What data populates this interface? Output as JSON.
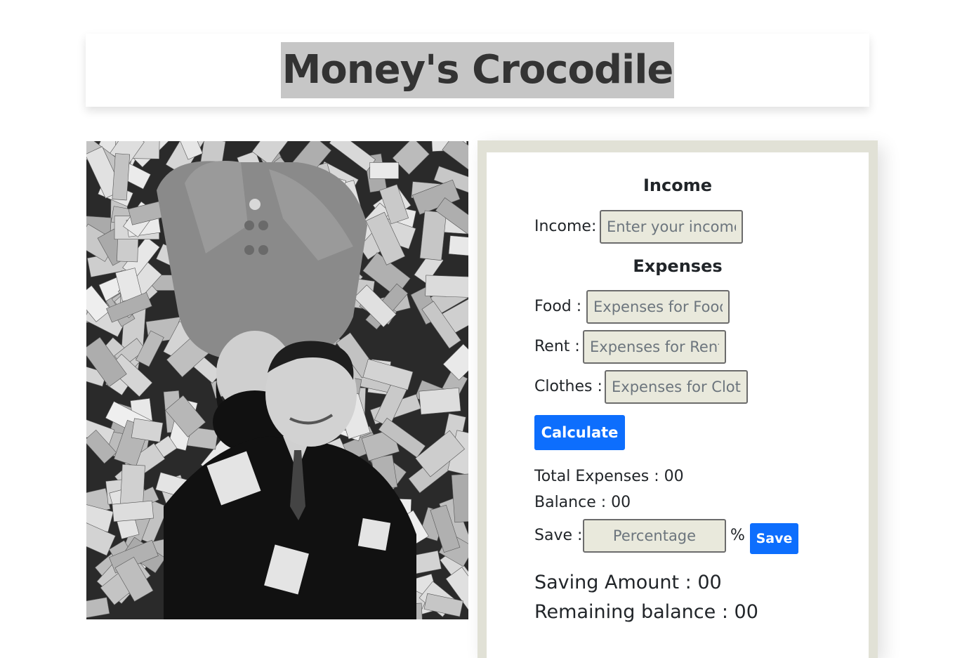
{
  "header": {
    "title": "Money's Crocodile"
  },
  "income_section": {
    "heading": "Income",
    "income_label": "Income:",
    "income_placeholder": "Enter your income"
  },
  "expenses_section": {
    "heading": "Expenses",
    "food_label": "Food :",
    "food_placeholder": "Expenses for Food",
    "rent_label": "Rent :",
    "rent_placeholder": "Expenses for Rent",
    "clothes_label": "Clothes :",
    "clothes_placeholder": "Expenses for Clothes"
  },
  "calculate_button": "Calculate",
  "totals": {
    "total_expenses_label": "Total Expenses :",
    "total_expenses_value": "00",
    "balance_label": "Balance :",
    "balance_value": "00"
  },
  "save_section": {
    "save_label": "Save :",
    "percentage_placeholder": "Percentage",
    "percent_symbol": "%",
    "save_button": "Save"
  },
  "savings": {
    "saving_amount_label": "Saving Amount :",
    "saving_amount_value": "00",
    "remaining_balance_label": "Remaining balance :",
    "remaining_balance_value": "00"
  },
  "colors": {
    "primary_button": "#0d6efd",
    "title_highlight": "#c6c6c6",
    "panel_background": "#e1e1d6",
    "input_background": "#e9e9dc"
  },
  "photo": {
    "icon": "money-couple-photo"
  }
}
